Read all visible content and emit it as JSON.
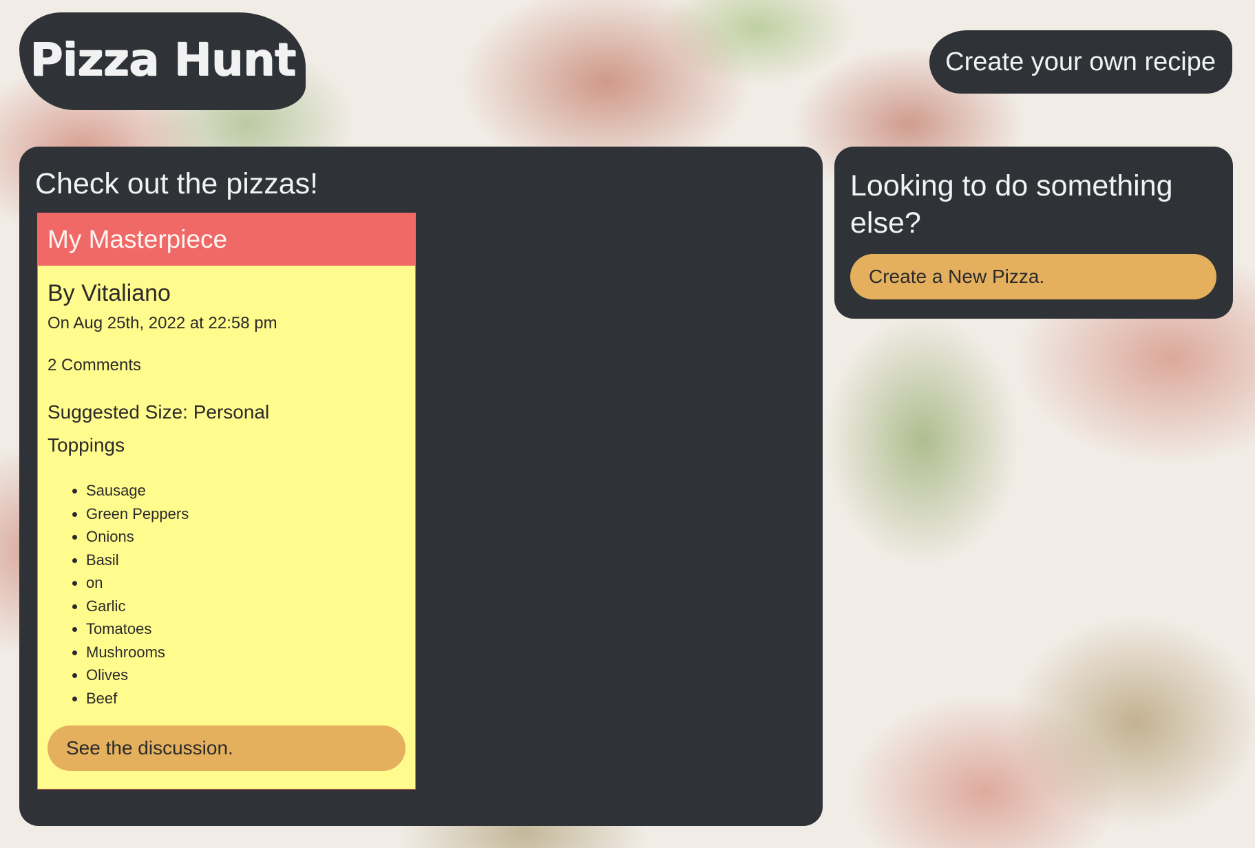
{
  "header": {
    "logo_text": "Pizza Hunt",
    "create_recipe_label": "Create your own recipe"
  },
  "main": {
    "title": "Check out the pizzas!",
    "pizza": {
      "name": "My Masterpiece",
      "author": "By Vitaliano",
      "date": "On Aug 25th, 2022 at 22:58 pm",
      "comments": "2 Comments",
      "size": "Suggested Size: Personal",
      "toppings_label": "Toppings",
      "toppings": [
        "Sausage",
        "Green Peppers",
        "Onions",
        "Basil",
        "on",
        "Garlic",
        "Tomatoes",
        "Mushrooms",
        "Olives",
        "Beef"
      ],
      "discussion_label": "See the discussion."
    }
  },
  "side": {
    "title": "Looking to do something else?",
    "new_pizza_label": "Create a New Pizza."
  },
  "colors": {
    "panel": "#2f3337",
    "card_bg": "#fffb8d",
    "card_header": "#f06966",
    "button": "#e4b05e"
  }
}
